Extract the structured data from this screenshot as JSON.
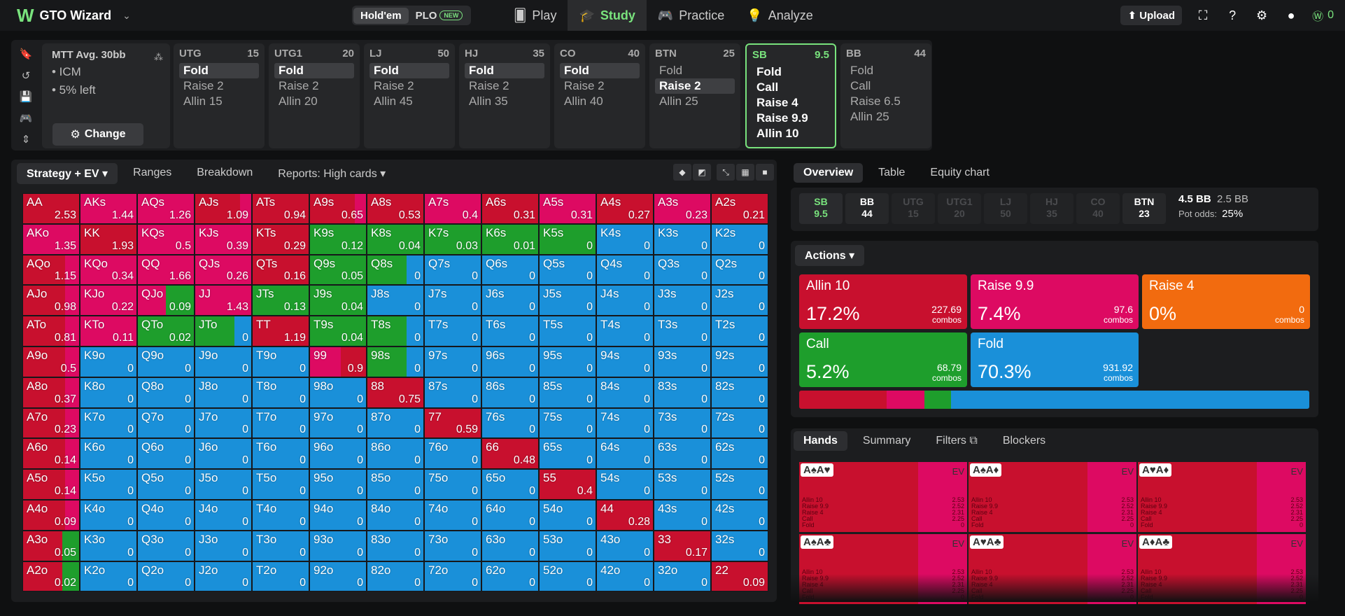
{
  "app": {
    "name": "GTO Wizard"
  },
  "mode_switch": {
    "holdem": "Hold'em",
    "plo": "PLO",
    "plo_badge": "NEW"
  },
  "nav": {
    "play": "Play",
    "study": "Study",
    "practice": "Practice",
    "analyze": "Analyze"
  },
  "topright": {
    "upload": "Upload",
    "coins": "0"
  },
  "mtt": {
    "title": "MTT  Avg. 30bb",
    "items": [
      "• ICM",
      "• 5% left"
    ],
    "change": "Change"
  },
  "positions": [
    {
      "name": "UTG",
      "stack": "15",
      "actions": [
        "Fold",
        "Raise 2",
        "Allin 15"
      ],
      "selected": 0
    },
    {
      "name": "UTG1",
      "stack": "20",
      "actions": [
        "Fold",
        "Raise 2",
        "Allin 20"
      ],
      "selected": 0
    },
    {
      "name": "LJ",
      "stack": "50",
      "actions": [
        "Fold",
        "Raise 2",
        "Allin 45"
      ],
      "selected": 0
    },
    {
      "name": "HJ",
      "stack": "35",
      "actions": [
        "Fold",
        "Raise 2",
        "Allin 35"
      ],
      "selected": 0
    },
    {
      "name": "CO",
      "stack": "40",
      "actions": [
        "Fold",
        "Raise 2",
        "Allin 40"
      ],
      "selected": 0
    },
    {
      "name": "BTN",
      "stack": "25",
      "actions": [
        "Fold",
        "Raise 2",
        "Allin 25"
      ],
      "selected": 1
    },
    {
      "name": "SB",
      "stack": "9.5",
      "actions": [
        "Fold",
        "Call",
        "Raise 4",
        "Raise 9.9",
        "Allin 10"
      ],
      "selected": -1,
      "current": true
    },
    {
      "name": "BB",
      "stack": "44",
      "actions": [
        "Fold",
        "Call",
        "Raise 6.5",
        "Allin 25"
      ],
      "selected": -1
    }
  ],
  "left_tabs": {
    "strategy": "Strategy + EV",
    "ranges": "Ranges",
    "breakdown": "Breakdown",
    "reports": "Reports: High cards"
  },
  "right_tabs": {
    "overview": "Overview",
    "table": "Table",
    "equity": "Equity chart"
  },
  "stacks": [
    {
      "pos": "SB",
      "stack": "9.5",
      "state": "current"
    },
    {
      "pos": "BB",
      "stack": "44",
      "state": "active"
    },
    {
      "pos": "UTG",
      "stack": "15",
      "state": "folded"
    },
    {
      "pos": "UTG1",
      "stack": "20",
      "state": "folded"
    },
    {
      "pos": "LJ",
      "stack": "50",
      "state": "folded"
    },
    {
      "pos": "HJ",
      "stack": "35",
      "state": "folded"
    },
    {
      "pos": "CO",
      "stack": "40",
      "state": "folded"
    },
    {
      "pos": "BTN",
      "stack": "23",
      "state": "active"
    }
  ],
  "pot": {
    "pot_bb": "4.5 BB",
    "call_bb": "2.5 BB",
    "odds_label": "Pot odds:",
    "odds": "25%"
  },
  "actions_header": "Actions",
  "action_cards": [
    {
      "name": "Allin 10",
      "pct": "17.2%",
      "combos": "227.69",
      "unit": "combos",
      "color": "#c8102e"
    },
    {
      "name": "Raise 9.9",
      "pct": "7.4%",
      "combos": "97.6",
      "unit": "combos",
      "color": "#dd0a62"
    },
    {
      "name": "Raise 4",
      "pct": "0%",
      "combos": "0",
      "unit": "combos",
      "color": "#f26b0f"
    },
    {
      "name": "Call",
      "pct": "5.2%",
      "combos": "68.79",
      "unit": "combos",
      "color": "#1e9e2c"
    },
    {
      "name": "Fold",
      "pct": "70.3%",
      "combos": "931.92",
      "unit": "combos",
      "color": "#1a90d9"
    }
  ],
  "freq_bar": [
    {
      "action": "Allin",
      "fraction": 0.172,
      "color": "#c8102e"
    },
    {
      "action": "Raise 9.9",
      "fraction": 0.074,
      "color": "#dd0a62"
    },
    {
      "action": "Call",
      "fraction": 0.052,
      "color": "#1e9e2c"
    },
    {
      "action": "Fold",
      "fraction": 0.703,
      "color": "#1a90d9"
    }
  ],
  "hand_tabs": {
    "hands": "Hands",
    "summary": "Summary",
    "filters": "Filters",
    "blockers": "Blockers"
  },
  "hand_cards": [
    {
      "cards": "A♠A♥",
      "ev": "EV"
    },
    {
      "cards": "A♠A♦",
      "ev": "EV"
    },
    {
      "cards": "A♥A♦",
      "ev": "EV"
    },
    {
      "cards": "A♠A♣",
      "ev": "EV"
    },
    {
      "cards": "A♥A♣",
      "ev": "EV"
    },
    {
      "cards": "A♦A♣",
      "ev": "EV"
    }
  ],
  "hand_rows": {
    "labels": [
      "Allin 10",
      "Raise 9.9",
      "Raise 4",
      "Call",
      "Fold"
    ],
    "values": [
      "2.53",
      "2.52",
      "2.31",
      "2.25",
      "0"
    ]
  },
  "colors": {
    "allin": "#c8102e",
    "raise": "#dd0a62",
    "call": "#1e9e2c",
    "fold": "#1a90d9",
    "accent": "#79e37d"
  },
  "matrix": [
    [
      "AA",
      "2.53",
      "A"
    ],
    [
      "AKs",
      "1.44",
      "R"
    ],
    [
      "AQs",
      "1.26",
      "R"
    ],
    [
      "AJs",
      "1.09",
      "A"
    ],
    [
      "ATs",
      "0.94",
      "A"
    ],
    [
      "A9s",
      "0.65",
      "A"
    ],
    [
      "A8s",
      "0.53",
      "A"
    ],
    [
      "A7s",
      "0.4",
      "R"
    ],
    [
      "A6s",
      "0.31",
      "A"
    ],
    [
      "A5s",
      "0.31",
      "R"
    ],
    [
      "A4s",
      "0.27",
      "A"
    ],
    [
      "A3s",
      "0.23",
      "R"
    ],
    [
      "A2s",
      "0.21",
      "A"
    ],
    [
      "AKo",
      "1.35",
      "R"
    ],
    [
      "KK",
      "1.93",
      "A"
    ],
    [
      "KQs",
      "0.5",
      "R"
    ],
    [
      "KJs",
      "0.39",
      "R"
    ],
    [
      "KTs",
      "0.29",
      "A"
    ],
    [
      "K9s",
      "0.12",
      "C"
    ],
    [
      "K8s",
      "0.04",
      "C"
    ],
    [
      "K7s",
      "0.03",
      "C"
    ],
    [
      "K6s",
      "0.01",
      "C"
    ],
    [
      "K5s",
      "0",
      "C"
    ],
    [
      "K4s",
      "0",
      "F"
    ],
    [
      "K3s",
      "0",
      "F"
    ],
    [
      "K2s",
      "0",
      "F"
    ],
    [
      "AQo",
      "1.15",
      "A"
    ],
    [
      "KQo",
      "0.34",
      "R"
    ],
    [
      "QQ",
      "1.66",
      "R"
    ],
    [
      "QJs",
      "0.26",
      "R"
    ],
    [
      "QTs",
      "0.16",
      "A"
    ],
    [
      "Q9s",
      "0.05",
      "C"
    ],
    [
      "Q8s",
      "0",
      "CF"
    ],
    [
      "Q7s",
      "0",
      "F"
    ],
    [
      "Q6s",
      "0",
      "F"
    ],
    [
      "Q5s",
      "0",
      "F"
    ],
    [
      "Q4s",
      "0",
      "F"
    ],
    [
      "Q3s",
      "0",
      "F"
    ],
    [
      "Q2s",
      "0",
      "F"
    ],
    [
      "AJo",
      "0.98",
      "A"
    ],
    [
      "KJo",
      "0.22",
      "R"
    ],
    [
      "QJo",
      "0.09",
      "RC"
    ],
    [
      "JJ",
      "1.43",
      "R"
    ],
    [
      "JTs",
      "0.13",
      "C"
    ],
    [
      "J9s",
      "0.04",
      "C"
    ],
    [
      "J8s",
      "0",
      "F"
    ],
    [
      "J7s",
      "0",
      "F"
    ],
    [
      "J6s",
      "0",
      "F"
    ],
    [
      "J5s",
      "0",
      "F"
    ],
    [
      "J4s",
      "0",
      "F"
    ],
    [
      "J3s",
      "0",
      "F"
    ],
    [
      "J2s",
      "0",
      "F"
    ],
    [
      "ATo",
      "0.81",
      "A"
    ],
    [
      "KTo",
      "0.11",
      "R"
    ],
    [
      "QTo",
      "0.02",
      "C"
    ],
    [
      "JTo",
      "0",
      "CF"
    ],
    [
      "TT",
      "1.19",
      "A"
    ],
    [
      "T9s",
      "0.04",
      "C"
    ],
    [
      "T8s",
      "0",
      "CF"
    ],
    [
      "T7s",
      "0",
      "F"
    ],
    [
      "T6s",
      "0",
      "F"
    ],
    [
      "T5s",
      "0",
      "F"
    ],
    [
      "T4s",
      "0",
      "F"
    ],
    [
      "T3s",
      "0",
      "F"
    ],
    [
      "T2s",
      "0",
      "F"
    ],
    [
      "A9o",
      "0.5",
      "A"
    ],
    [
      "K9o",
      "0",
      "F"
    ],
    [
      "Q9o",
      "0",
      "F"
    ],
    [
      "J9o",
      "0",
      "F"
    ],
    [
      "T9o",
      "0",
      "F"
    ],
    [
      "99",
      "0.9",
      "RA"
    ],
    [
      "98s",
      "0",
      "CF"
    ],
    [
      "97s",
      "0",
      "F"
    ],
    [
      "96s",
      "0",
      "F"
    ],
    [
      "95s",
      "0",
      "F"
    ],
    [
      "94s",
      "0",
      "F"
    ],
    [
      "93s",
      "0",
      "F"
    ],
    [
      "92s",
      "0",
      "F"
    ],
    [
      "A8o",
      "0.37",
      "A"
    ],
    [
      "K8o",
      "0",
      "F"
    ],
    [
      "Q8o",
      "0",
      "F"
    ],
    [
      "J8o",
      "0",
      "F"
    ],
    [
      "T8o",
      "0",
      "F"
    ],
    [
      "98o",
      "0",
      "F"
    ],
    [
      "88",
      "0.75",
      "A"
    ],
    [
      "87s",
      "0",
      "F"
    ],
    [
      "86s",
      "0",
      "F"
    ],
    [
      "85s",
      "0",
      "F"
    ],
    [
      "84s",
      "0",
      "F"
    ],
    [
      "83s",
      "0",
      "F"
    ],
    [
      "82s",
      "0",
      "F"
    ],
    [
      "A7o",
      "0.23",
      "A"
    ],
    [
      "K7o",
      "0",
      "F"
    ],
    [
      "Q7o",
      "0",
      "F"
    ],
    [
      "J7o",
      "0",
      "F"
    ],
    [
      "T7o",
      "0",
      "F"
    ],
    [
      "97o",
      "0",
      "F"
    ],
    [
      "87o",
      "0",
      "F"
    ],
    [
      "77",
      "0.59",
      "A"
    ],
    [
      "76s",
      "0",
      "F"
    ],
    [
      "75s",
      "0",
      "F"
    ],
    [
      "74s",
      "0",
      "F"
    ],
    [
      "73s",
      "0",
      "F"
    ],
    [
      "72s",
      "0",
      "F"
    ],
    [
      "A6o",
      "0.14",
      "A"
    ],
    [
      "K6o",
      "0",
      "F"
    ],
    [
      "Q6o",
      "0",
      "F"
    ],
    [
      "J6o",
      "0",
      "F"
    ],
    [
      "T6o",
      "0",
      "F"
    ],
    [
      "96o",
      "0",
      "F"
    ],
    [
      "86o",
      "0",
      "F"
    ],
    [
      "76o",
      "0",
      "F"
    ],
    [
      "66",
      "0.48",
      "A"
    ],
    [
      "65s",
      "0",
      "F"
    ],
    [
      "64s",
      "0",
      "F"
    ],
    [
      "63s",
      "0",
      "F"
    ],
    [
      "62s",
      "0",
      "F"
    ],
    [
      "A5o",
      "0.14",
      "A"
    ],
    [
      "K5o",
      "0",
      "F"
    ],
    [
      "Q5o",
      "0",
      "F"
    ],
    [
      "J5o",
      "0",
      "F"
    ],
    [
      "T5o",
      "0",
      "F"
    ],
    [
      "95o",
      "0",
      "F"
    ],
    [
      "85o",
      "0",
      "F"
    ],
    [
      "75o",
      "0",
      "F"
    ],
    [
      "65o",
      "0",
      "F"
    ],
    [
      "55",
      "0.4",
      "A"
    ],
    [
      "54s",
      "0",
      "F"
    ],
    [
      "53s",
      "0",
      "F"
    ],
    [
      "52s",
      "0",
      "F"
    ],
    [
      "A4o",
      "0.09",
      "A"
    ],
    [
      "K4o",
      "0",
      "F"
    ],
    [
      "Q4o",
      "0",
      "F"
    ],
    [
      "J4o",
      "0",
      "F"
    ],
    [
      "T4o",
      "0",
      "F"
    ],
    [
      "94o",
      "0",
      "F"
    ],
    [
      "84o",
      "0",
      "F"
    ],
    [
      "74o",
      "0",
      "F"
    ],
    [
      "64o",
      "0",
      "F"
    ],
    [
      "54o",
      "0",
      "F"
    ],
    [
      "44",
      "0.28",
      "A"
    ],
    [
      "43s",
      "0",
      "F"
    ],
    [
      "42s",
      "0",
      "F"
    ],
    [
      "A3o",
      "0.05",
      "AC"
    ],
    [
      "K3o",
      "0",
      "F"
    ],
    [
      "Q3o",
      "0",
      "F"
    ],
    [
      "J3o",
      "0",
      "F"
    ],
    [
      "T3o",
      "0",
      "F"
    ],
    [
      "93o",
      "0",
      "F"
    ],
    [
      "83o",
      "0",
      "F"
    ],
    [
      "73o",
      "0",
      "F"
    ],
    [
      "63o",
      "0",
      "F"
    ],
    [
      "53o",
      "0",
      "F"
    ],
    [
      "43o",
      "0",
      "F"
    ],
    [
      "33",
      "0.17",
      "A"
    ],
    [
      "32s",
      "0",
      "F"
    ],
    [
      "A2o",
      "0.02",
      "AC"
    ],
    [
      "K2o",
      "0",
      "F"
    ],
    [
      "Q2o",
      "0",
      "F"
    ],
    [
      "J2o",
      "0",
      "F"
    ],
    [
      "T2o",
      "0",
      "F"
    ],
    [
      "92o",
      "0",
      "F"
    ],
    [
      "82o",
      "0",
      "F"
    ],
    [
      "72o",
      "0",
      "F"
    ],
    [
      "62o",
      "0",
      "F"
    ],
    [
      "52o",
      "0",
      "F"
    ],
    [
      "42o",
      "0",
      "F"
    ],
    [
      "32o",
      "0",
      "F"
    ],
    [
      "22",
      "0.09",
      "A"
    ]
  ]
}
